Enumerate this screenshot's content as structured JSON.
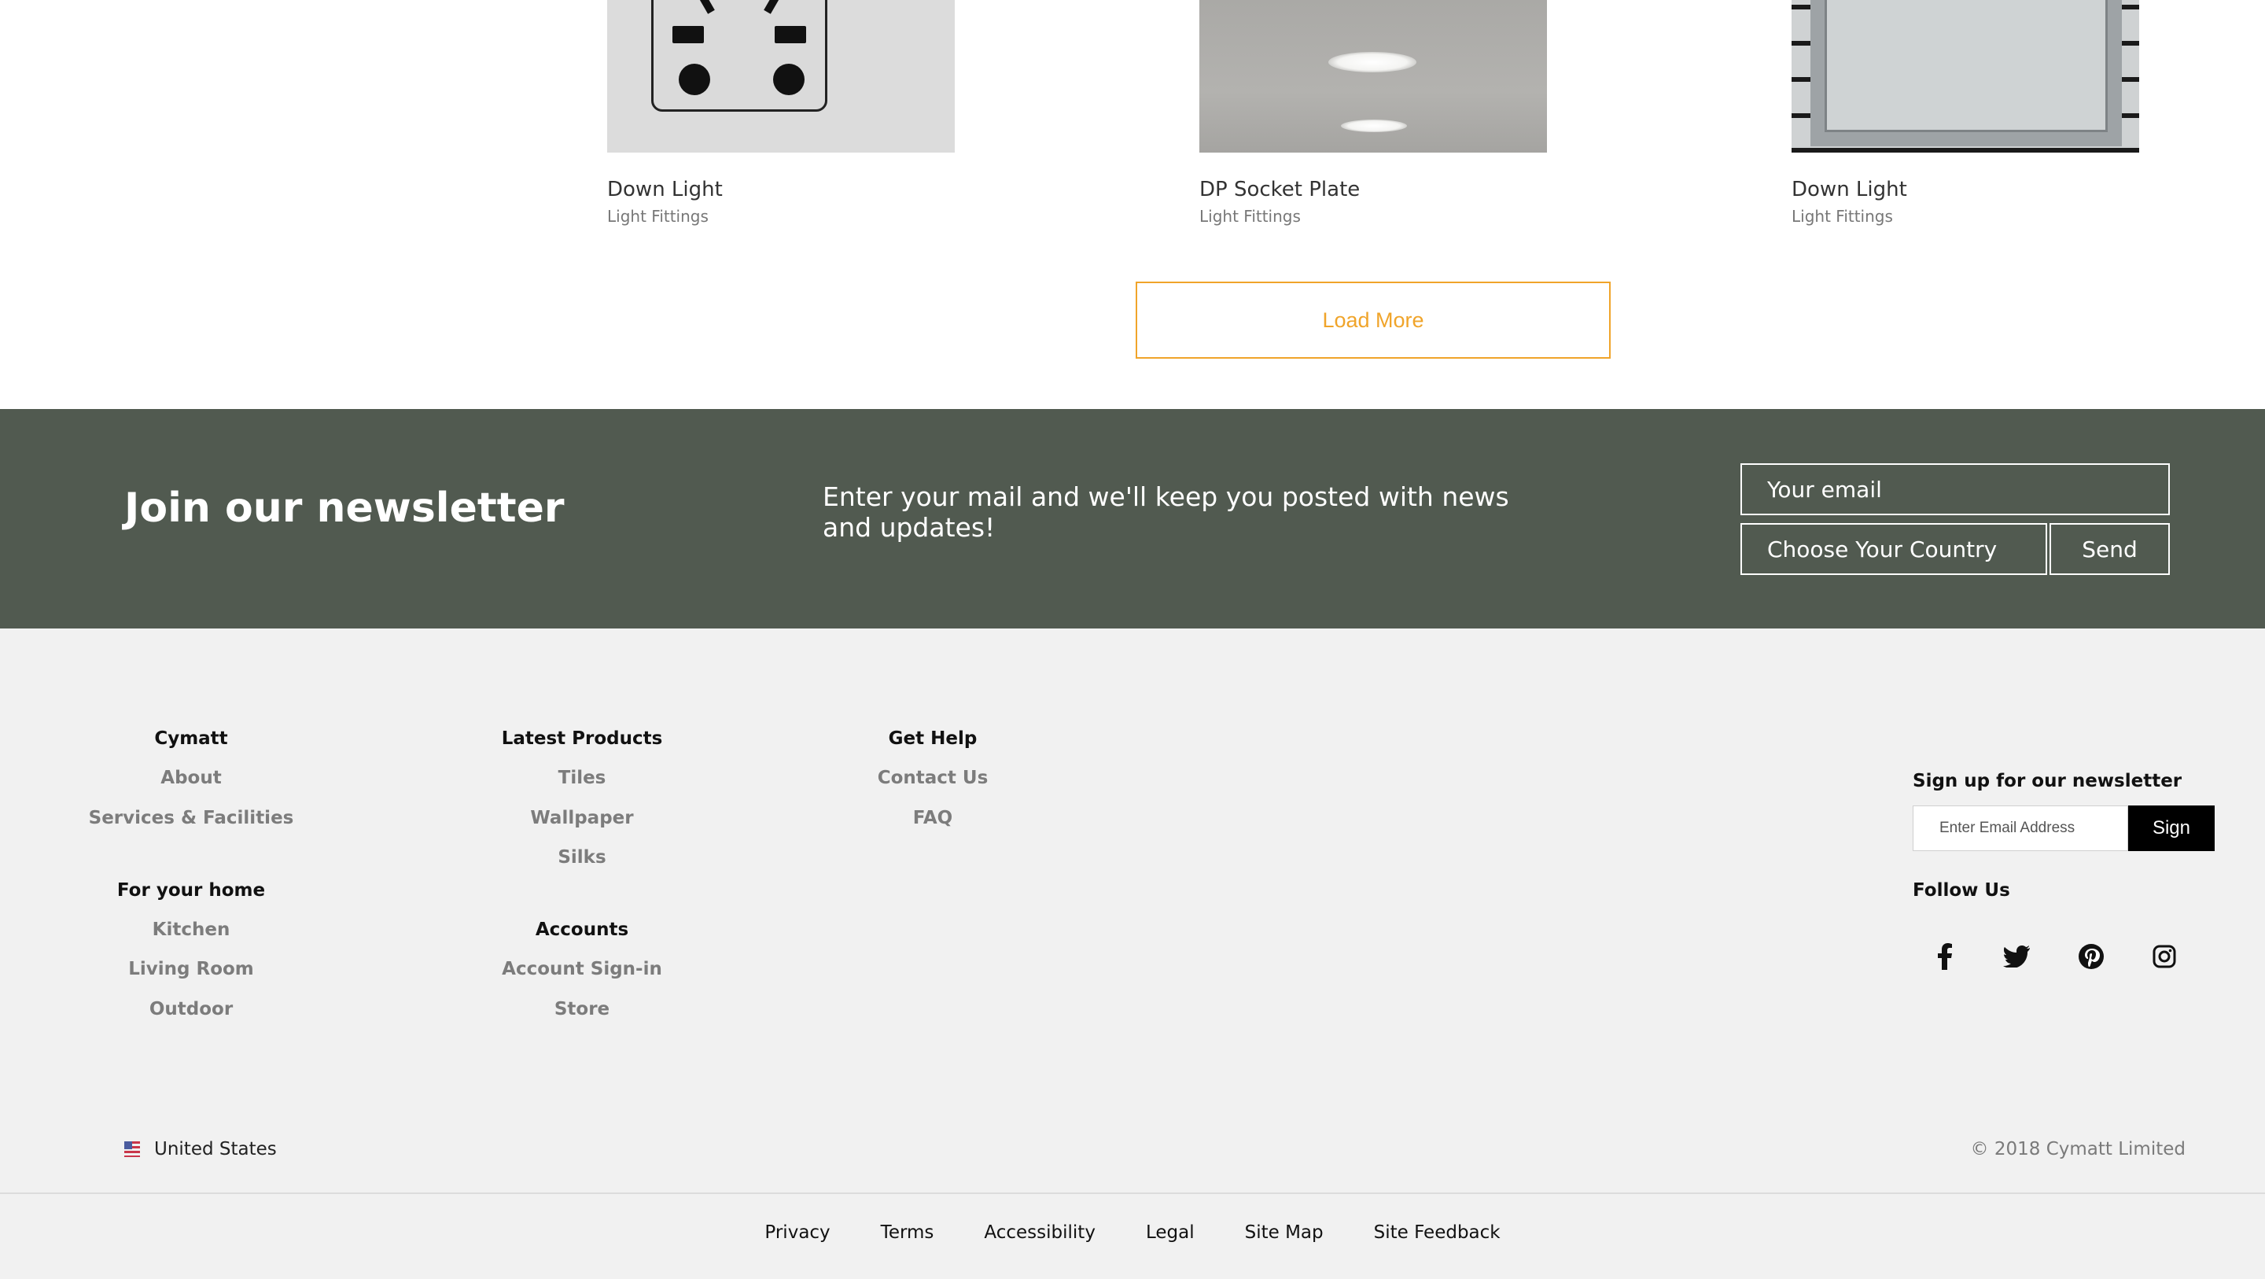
{
  "products": [
    {
      "name": "Down Light",
      "category": "Light Fittings",
      "image": "wall-socket-image"
    },
    {
      "name": "DP Socket Plate",
      "category": "Light Fittings",
      "image": "ceiling-downlight-image"
    },
    {
      "name": "Down Light",
      "category": "Light Fittings",
      "image": "mirror-frame-image"
    }
  ],
  "load_more_label": "Load More",
  "newsletter": {
    "title": "Join our newsletter",
    "description": "Enter your mail and we'll keep you posted with news and updates!",
    "email_placeholder": "Your email",
    "country_placeholder": "Choose Your Country",
    "send_label": "Send",
    "background_color": "#515a50"
  },
  "footer": {
    "columns": [
      {
        "sections": [
          {
            "heading": "Cymatt",
            "links": [
              "About",
              "Services & Facilities"
            ]
          },
          {
            "heading": "For your home",
            "links": [
              "Kitchen",
              "Living Room",
              "Outdoor"
            ]
          }
        ]
      },
      {
        "sections": [
          {
            "heading": "Latest Products",
            "links": [
              "Tiles",
              "Wallpaper",
              "Silks"
            ]
          },
          {
            "heading": "Accounts",
            "links": [
              "Account Sign-in",
              "Store"
            ]
          }
        ]
      },
      {
        "sections": [
          {
            "heading": "Get Help",
            "links": [
              "Contact Us",
              "FAQ"
            ]
          }
        ]
      }
    ],
    "signup": {
      "title": "Sign up for our newsletter",
      "placeholder": "Enter Email Address",
      "button_label": "Sign"
    },
    "follow_title": "Follow Us",
    "social_icons": [
      "facebook-icon",
      "twitter-icon",
      "pinterest-icon",
      "instagram-icon"
    ],
    "region": "United States",
    "region_icon": "us-flag-icon",
    "copyright": "© 2018 Cymatt Limited",
    "bottom_links": [
      "Privacy",
      "Terms",
      "Accessibility",
      "Legal",
      "Site Map",
      "Site Feedback"
    ]
  },
  "colors": {
    "accent": "#f0a42a",
    "footer_bg": "#f1f1f1"
  }
}
